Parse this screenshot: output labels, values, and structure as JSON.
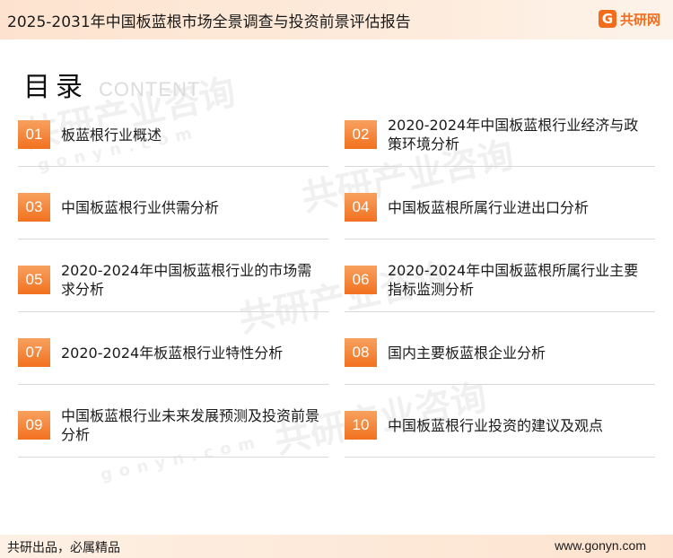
{
  "header": {
    "title": "2025-2031年中国板蓝根市场全景调查与投资前景评估报告",
    "logo_mark": "G",
    "logo_text": "共研网"
  },
  "heading": {
    "main": "目录",
    "sub": "CONTENT"
  },
  "watermark": {
    "brand": "共研产业咨询",
    "site": "gonyn.com"
  },
  "toc": [
    {
      "num": "01",
      "label": "板蓝根行业概述"
    },
    {
      "num": "02",
      "label": "2020-2024年中国板蓝根行业经济与政策环境分析"
    },
    {
      "num": "03",
      "label": "中国板蓝根行业供需分析"
    },
    {
      "num": "04",
      "label": "中国板蓝根所属行业进出口分析"
    },
    {
      "num": "05",
      "label": "2020-2024年中国板蓝根行业的市场需求分析"
    },
    {
      "num": "06",
      "label": "2020-2024年中国板蓝根所属行业主要指标监测分析"
    },
    {
      "num": "07",
      "label": "2020-2024年板蓝根行业特性分析"
    },
    {
      "num": "08",
      "label": "国内主要板蓝根企业分析"
    },
    {
      "num": "09",
      "label": "中国板蓝根行业未来发展预测及投资前景分析"
    },
    {
      "num": "10",
      "label": "中国板蓝根行业投资的建议及观点"
    }
  ],
  "footer": {
    "left": "共研出品，必属精品",
    "right": "www.gonyn.com"
  },
  "colors": {
    "accent": "#f2711f",
    "header_bg": "#fde3cf"
  }
}
